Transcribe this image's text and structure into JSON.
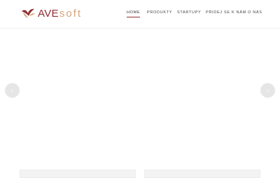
{
  "brand": {
    "name_part1": "AVE",
    "name_part2": "soft",
    "color_primary": "#8f2e32",
    "color_secondary": "#d7a47c",
    "icon": "bird-logo-icon"
  },
  "nav": {
    "items": [
      {
        "label": "HOME",
        "active": true
      },
      {
        "label": "PRODUKTY",
        "active": false
      },
      {
        "label": "STARTUPY",
        "active": false
      },
      {
        "label": "PŘIDEJ SE K NÁM",
        "active": false
      },
      {
        "label": "O NÁS",
        "active": false
      }
    ]
  },
  "slider": {
    "prev_icon": "chevron-left-icon",
    "next_icon": "chevron-right-icon",
    "prev_glyph": "‹",
    "next_glyph": "›"
  }
}
